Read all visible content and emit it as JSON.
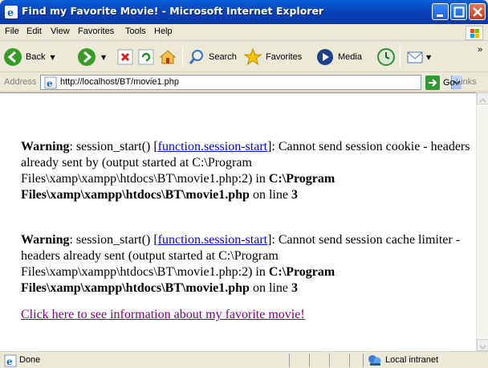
{
  "window": {
    "title": "Find my Favorite Movie! - Microsoft Internet Explorer"
  },
  "menu": [
    "File",
    "Edit",
    "View",
    "Favorites",
    "Tools",
    "Help"
  ],
  "toolbar": {
    "back_label": "Back",
    "search_label": "Search",
    "favorites_label": "Favorites",
    "media_label": "Media"
  },
  "address": {
    "label": "Address",
    "url": "http://localhost/BT/movie1.php",
    "go_label": "Go",
    "links_label": "Links"
  },
  "page": {
    "warning1": {
      "bold": "Warning",
      "text1": ": session_start() [",
      "link": "function.session-start",
      "text2": "]: Cannot send session cookie - headers already sent by (output started at C:\\Program Files\\xamp\\xampp\\htdocs\\BT\\movie1.php:2) in ",
      "path_bold": "C:\\Program Files\\xamp\\xampp\\htdocs\\BT\\movie1.php",
      "text3": " on line ",
      "line": "3"
    },
    "warning2": {
      "bold": "Warning",
      "text1": ": session_start() [",
      "link": "function.session-start",
      "text2": "]: Cannot send session cache limiter - headers already sent (output started at C:\\Program Files\\xamp\\xampp\\htdocs\\BT\\movie1.php:2) in ",
      "path_bold": "C:\\Program Files\\xamp\\xampp\\htdocs\\BT\\movie1.php",
      "text3": " on line ",
      "line": "3"
    },
    "info_link": "Click here to see information about my favorite movie!"
  },
  "status": {
    "text": "Done",
    "zone": "Local intranet"
  }
}
